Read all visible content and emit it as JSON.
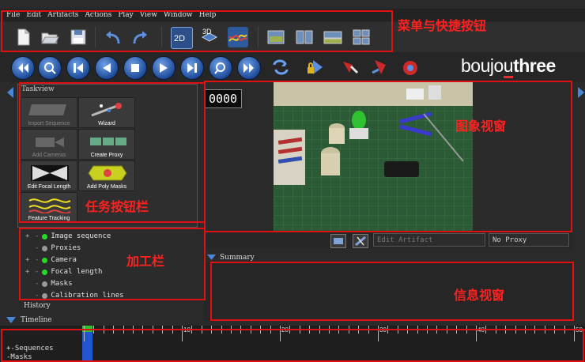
{
  "menu": [
    "File",
    "Edit",
    "Artifacts",
    "Actions",
    "Play",
    "View",
    "Window",
    "Help"
  ],
  "toolbar1": {
    "buttons": [
      "new-icon",
      "open-icon",
      "save-icon",
      "undo-icon",
      "redo-icon",
      "view-2d-icon",
      "view-3d-icon",
      "graph-icon",
      "layout-single-icon",
      "layout-dual-icon",
      "layout-wide-icon",
      "layout-quad-icon"
    ],
    "view_2d_label": "2D",
    "view_3d_label": "3D"
  },
  "toolbar2": {
    "play_controls": [
      "go-to-start-icon",
      "previous-keyframe-icon",
      "step-back-icon",
      "play-reverse-icon",
      "stop-icon",
      "play-icon",
      "step-forward-icon",
      "next-keyframe-icon",
      "go-to-end-icon"
    ],
    "extra_tools": [
      "loop-icon",
      "lock-track-icon",
      "camera-solve-icon",
      "track-solve-icon",
      "render-icon"
    ]
  },
  "logo": {
    "a": "boujo",
    "b": "u",
    "c": "three"
  },
  "taskview": {
    "title": "Taskview",
    "tasks": [
      {
        "label": "Import Sequence",
        "enabled": false
      },
      {
        "label": "Wizard",
        "enabled": true
      },
      {
        "label": "Add Cameras",
        "enabled": false
      },
      {
        "label": "Create Proxy",
        "enabled": true
      },
      {
        "label": "Edit Focal Length",
        "enabled": true
      },
      {
        "label": "Add Poly Masks",
        "enabled": true
      },
      {
        "label": "Feature Tracking",
        "enabled": true
      }
    ]
  },
  "tree": [
    {
      "label": "Image sequence",
      "expand": "+",
      "status": "#22dd22"
    },
    {
      "label": "Proxies",
      "expand": "",
      "status": "#9a9a9a"
    },
    {
      "label": "Camera",
      "expand": "+",
      "status": "#22dd22"
    },
    {
      "label": "Focal length",
      "expand": "+",
      "status": "#22dd22"
    },
    {
      "label": "Masks",
      "expand": "",
      "status": "#9a9a9a"
    },
    {
      "label": "Calibration lines",
      "expand": "",
      "status": "#9a9a9a"
    }
  ],
  "history_label": "History",
  "timeline_label": "Timeline",
  "frame_counter": "0000",
  "image_bar": {
    "artifact": "Edit Artifact",
    "proxy": "No Proxy"
  },
  "summary_label": "Summary",
  "timeline": {
    "tick_labels": [
      "10",
      "20",
      "30",
      "40",
      "50"
    ],
    "rows": [
      "+-Sequences",
      "-Masks"
    ]
  },
  "annotations": {
    "menu_toolbar": "菜单与快捷按钮",
    "image_view": "图象视窗",
    "task_buttons": "任务按钮栏",
    "processing": "加工栏",
    "info_view": "信息视窗"
  },
  "colors": {
    "accent_red": "#e01010",
    "status_green": "#22dd22",
    "play_blue": "#2a5db0"
  }
}
